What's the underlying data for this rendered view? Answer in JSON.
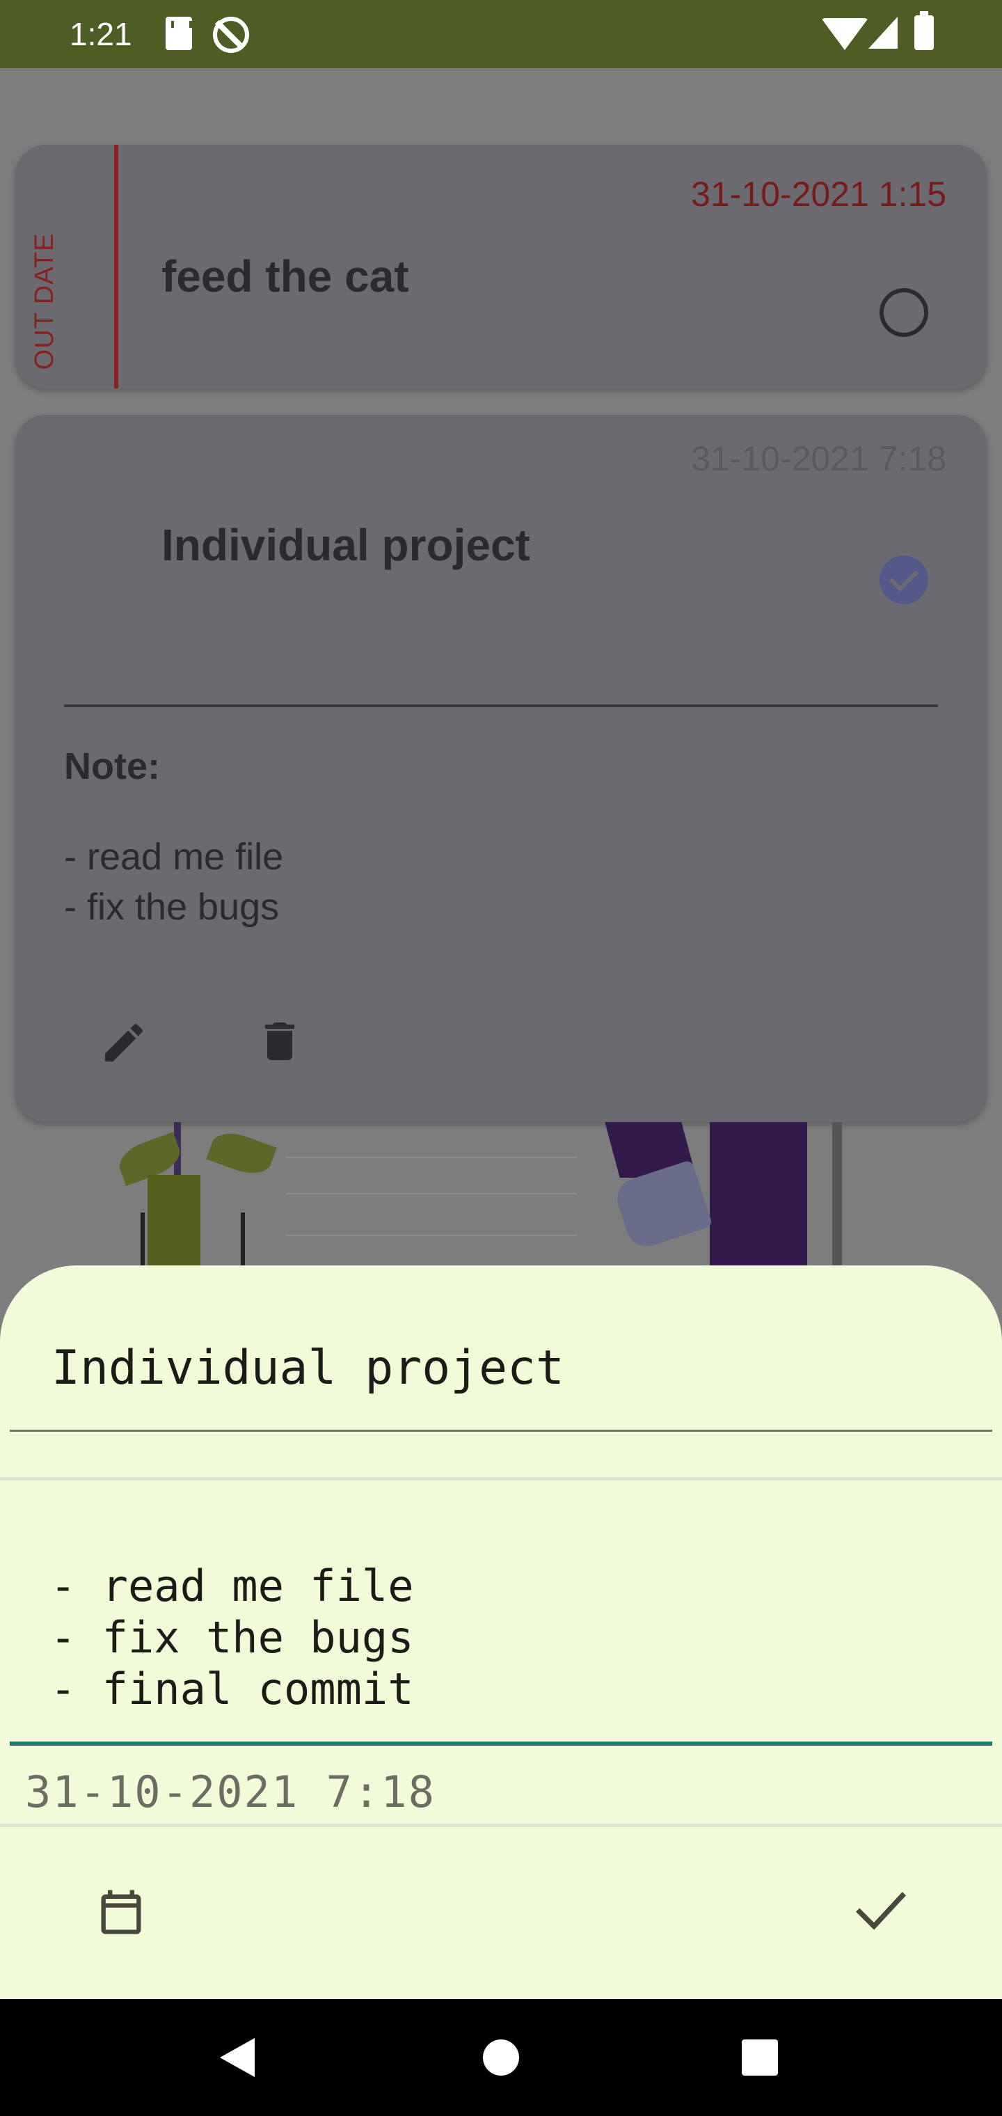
{
  "status_bar": {
    "time": "1:21",
    "icons": [
      "sd-card-icon",
      "sync-off-icon",
      "wifi-icon",
      "signal-icon",
      "battery-icon"
    ],
    "background_color": "#4e5d24"
  },
  "tasks": [
    {
      "status_label": "OUT DATE",
      "date": "31-10-2021 1:15",
      "title": "feed the cat",
      "completed": false
    },
    {
      "date": "31-10-2021 7:18",
      "title": "Individual project",
      "completed": true,
      "note_label": "Note:",
      "note_lines": [
        "- read me file",
        "- fix the bugs"
      ],
      "actions": [
        "edit-icon",
        "delete-icon"
      ]
    }
  ],
  "edit_sheet": {
    "title_value": "Individual project",
    "note_value": "- read me file\n- fix the bugs\n- final commit",
    "date_value": "31-10-2021 7:18",
    "calendar_icon": "calendar-icon",
    "confirm_icon": "check-icon",
    "background_color": "#f1fbd9",
    "accent_color": "#1d7a6e"
  },
  "nav_bar": {
    "buttons": [
      "back-icon",
      "home-icon",
      "recents-icon"
    ]
  }
}
